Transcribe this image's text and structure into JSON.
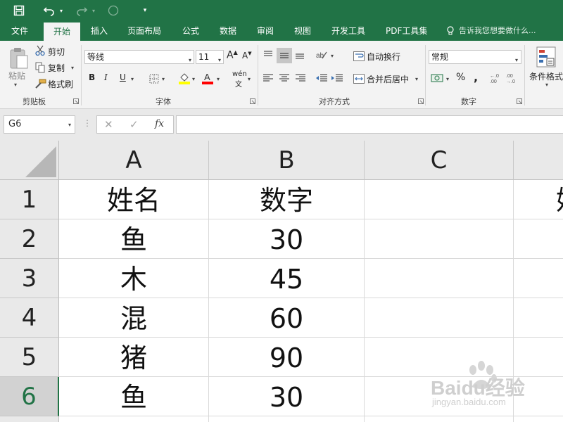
{
  "quick_access": {
    "save_icon": "save-icon",
    "undo_icon": "undo-icon",
    "redo_icon": "redo-icon",
    "touch_icon": "touch-mode-icon",
    "customize_icon": "customize-qat-icon"
  },
  "tabs": [
    {
      "label": "文件",
      "active": false
    },
    {
      "label": "开始",
      "active": true
    },
    {
      "label": "插入",
      "active": false
    },
    {
      "label": "页面布局",
      "active": false
    },
    {
      "label": "公式",
      "active": false
    },
    {
      "label": "数据",
      "active": false
    },
    {
      "label": "审阅",
      "active": false
    },
    {
      "label": "视图",
      "active": false
    },
    {
      "label": "开发工具",
      "active": false
    },
    {
      "label": "PDF工具集",
      "active": false
    }
  ],
  "tell_me": "告诉我您想要做什么...",
  "ribbon": {
    "clipboard": {
      "paste": "粘贴",
      "cut": "剪切",
      "copy": "复制",
      "format_painter": "格式刷",
      "group_label": "剪贴板"
    },
    "font": {
      "font_name": "等线",
      "font_size": "11",
      "bold": "B",
      "italic": "I",
      "underline": "U",
      "phonetic": "wén",
      "group_label": "字体"
    },
    "alignment": {
      "wrap_text": "自动换行",
      "merge_center": "合并后居中",
      "group_label": "对齐方式"
    },
    "number": {
      "format": "常规",
      "percent": "%",
      "comma": ",",
      "group_label": "数字"
    },
    "styles": {
      "conditional_format": "条件格式"
    }
  },
  "formula_bar": {
    "name_box": "G6",
    "fx": "fx",
    "value": ""
  },
  "sheet": {
    "columns": [
      "A",
      "B",
      "C"
    ],
    "rows": [
      {
        "num": "1",
        "a": "姓名",
        "b": "数字",
        "d": "姓"
      },
      {
        "num": "2",
        "a": "鱼",
        "b": "30"
      },
      {
        "num": "3",
        "a": "木",
        "b": "45"
      },
      {
        "num": "4",
        "a": "混",
        "b": "60"
      },
      {
        "num": "5",
        "a": "猪",
        "b": "90"
      },
      {
        "num": "6",
        "a": "鱼",
        "b": "30"
      }
    ],
    "selected_row": "6"
  },
  "watermark": {
    "brand": "Baidu经验",
    "url": "jingyan.baidu.com"
  },
  "colors": {
    "accent": "#217346",
    "ribbon_bg": "#f3f3f3",
    "header_bg": "#e9e9e9"
  }
}
